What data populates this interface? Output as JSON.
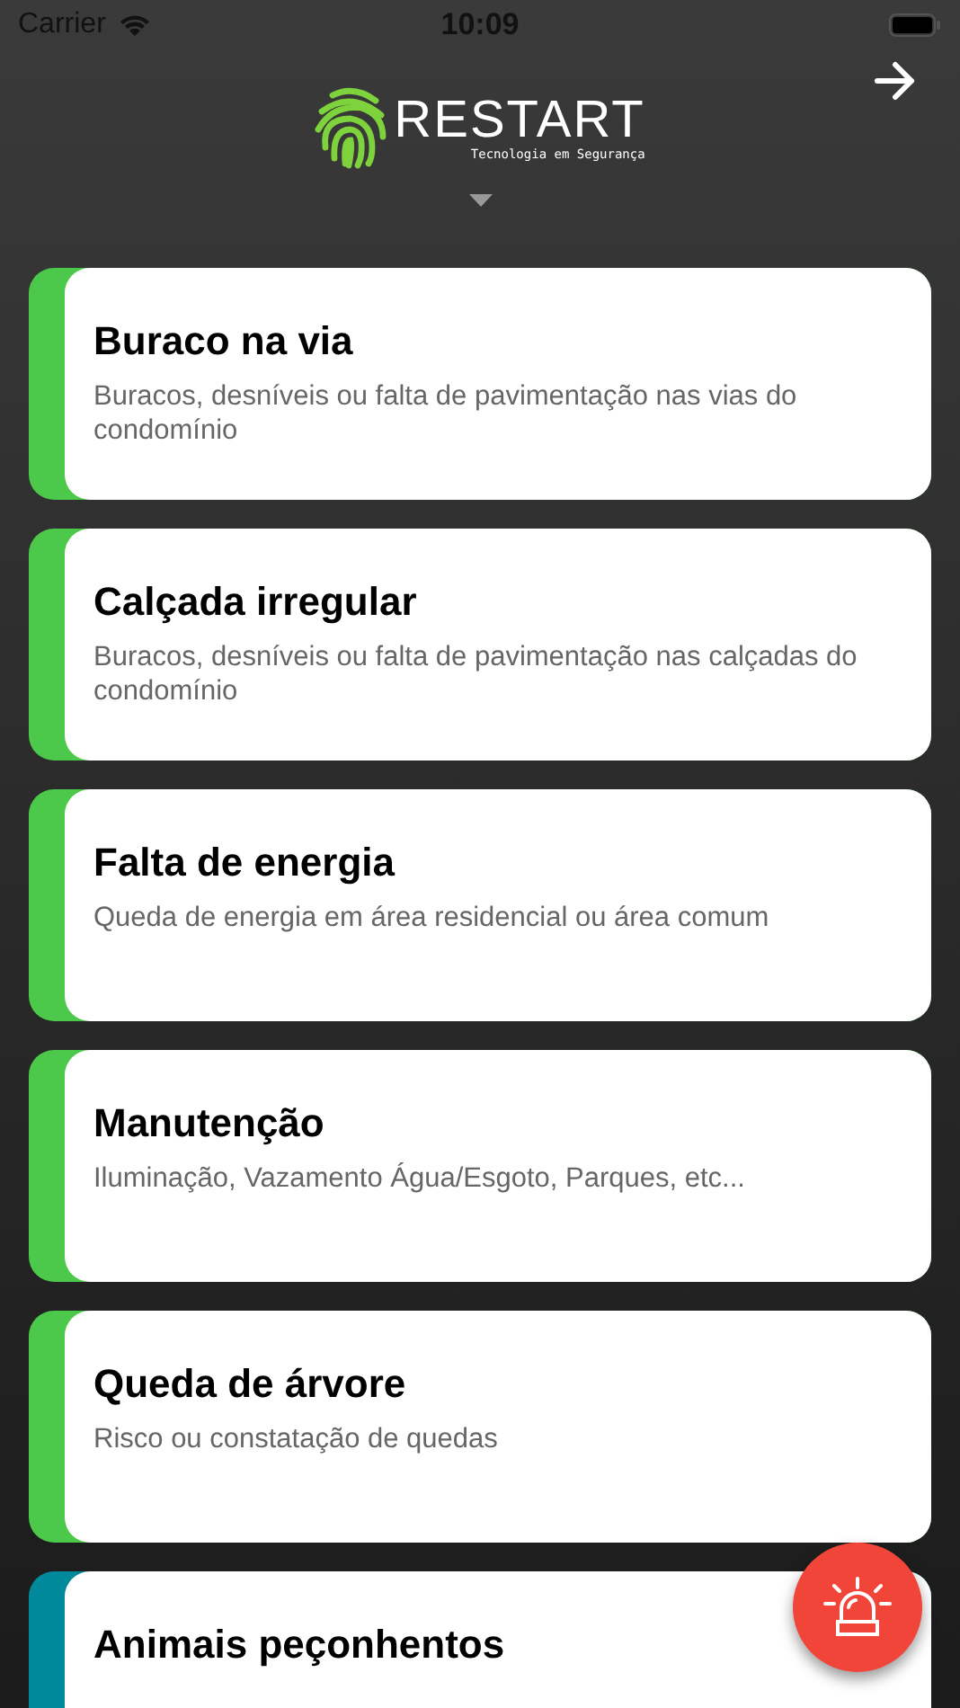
{
  "status_bar": {
    "carrier": "Carrier",
    "time": "10:09"
  },
  "header": {
    "brand": "RESTART",
    "tagline": "Tecnologia em Segurança"
  },
  "categories": [
    {
      "title": "Buraco na via",
      "description": "Buracos, desníveis ou falta de pavimentação nas vias do condomínio",
      "color": "#4cc84a"
    },
    {
      "title": "Calçada irregular",
      "description": "Buracos, desníveis ou falta de pavimentação nas calçadas do condomínio",
      "color": "#4cc84a"
    },
    {
      "title": "Falta de energia",
      "description": "Queda de energia em área residencial ou área comum",
      "color": "#4cc84a"
    },
    {
      "title": "Manutenção",
      "description": "Iluminação, Vazamento Água/Esgoto, Parques, etc...",
      "color": "#4cc84a"
    },
    {
      "title": "Queda de árvore",
      "description": "Risco ou constatação de quedas",
      "color": "#4cc84a"
    },
    {
      "title": "Animais peçonhentos",
      "color": "#00899b"
    }
  ]
}
